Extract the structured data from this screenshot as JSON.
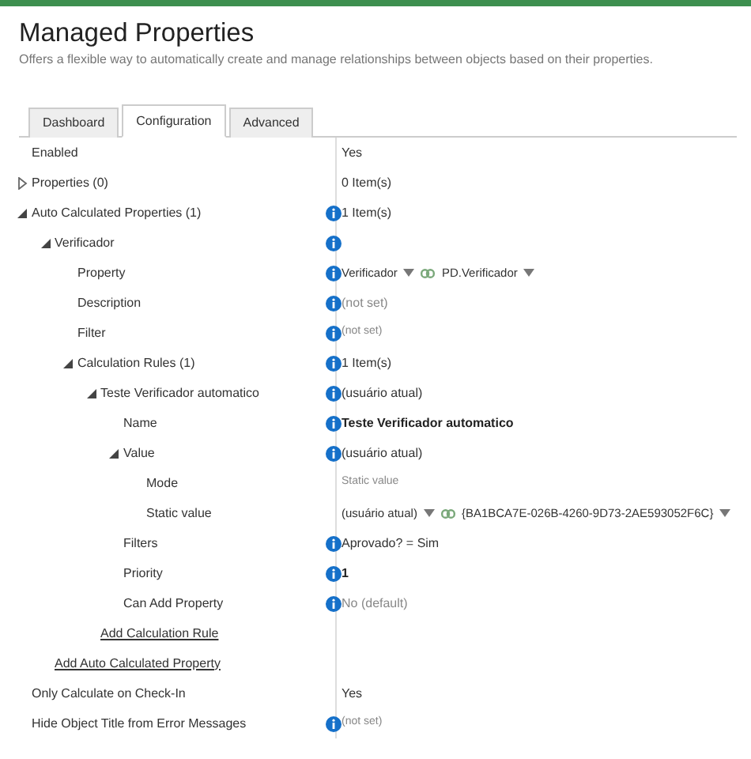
{
  "header": {
    "title": "Managed Properties",
    "subtitle": "Offers a flexible way to automatically create and manage relationships between objects based on their properties."
  },
  "tabs": [
    {
      "label": "Dashboard",
      "selected": false
    },
    {
      "label": "Configuration",
      "selected": true
    },
    {
      "label": "Advanced",
      "selected": false
    }
  ],
  "properties": [
    {
      "kind": "row",
      "label": "Enabled",
      "info": false,
      "value": {
        "kind": "plain",
        "text": "Yes"
      }
    },
    {
      "kind": "row",
      "label": "Properties (0)",
      "expanded": false,
      "info": false,
      "value": {
        "kind": "plain",
        "text": "0 Item(s)"
      }
    },
    {
      "kind": "row",
      "label": "Auto Calculated Properties (1)",
      "expanded": true,
      "info": true,
      "value": {
        "kind": "plain",
        "text": "1 Item(s)"
      },
      "children": [
        {
          "kind": "row",
          "label": "Verificador",
          "expanded": true,
          "info": true,
          "children": [
            {
              "kind": "row",
              "label": "Property",
              "info": true,
              "value": {
                "kind": "lookup",
                "left": "Verificador",
                "right": "PD.Verificador"
              }
            },
            {
              "kind": "row",
              "label": "Description",
              "info": true,
              "value": {
                "kind": "muted",
                "text": "(not set)"
              }
            },
            {
              "kind": "row",
              "label": "Filter",
              "info": true,
              "value": {
                "kind": "small",
                "text": "(not set)"
              }
            },
            {
              "kind": "row",
              "label": "Calculation Rules (1)",
              "expanded": true,
              "info": true,
              "value": {
                "kind": "plain",
                "text": "1 Item(s)"
              },
              "children": [
                {
                  "kind": "row",
                  "label": "Teste Verificador automatico",
                  "expanded": true,
                  "info": true,
                  "value": {
                    "kind": "plain",
                    "text": "(usuário atual)"
                  },
                  "children": [
                    {
                      "kind": "row",
                      "label": "Name",
                      "info": true,
                      "value": {
                        "kind": "bold",
                        "text": "Teste Verificador automatico"
                      }
                    },
                    {
                      "kind": "row",
                      "label": "Value",
                      "expanded": true,
                      "info": true,
                      "value": {
                        "kind": "plain",
                        "text": "(usuário atual)"
                      },
                      "children": [
                        {
                          "kind": "row",
                          "label": "Mode",
                          "info": false,
                          "value": {
                            "kind": "small",
                            "text": "Static value"
                          }
                        },
                        {
                          "kind": "row",
                          "label": "Static value",
                          "info": false,
                          "value": {
                            "kind": "lookup",
                            "left": "(usuário atual)",
                            "right": "{BA1BCA7E-026B-4260-9D73-2AE593052F6C}"
                          }
                        }
                      ]
                    },
                    {
                      "kind": "row",
                      "label": "Filters",
                      "info": true,
                      "value": {
                        "kind": "plain",
                        "text": "Aprovado?  =  Sim"
                      }
                    },
                    {
                      "kind": "row",
                      "label": "Priority",
                      "info": true,
                      "value": {
                        "kind": "bold",
                        "text": "1"
                      }
                    },
                    {
                      "kind": "row",
                      "label": "Can Add Property",
                      "info": true,
                      "value": {
                        "kind": "muted",
                        "text": "No (default)"
                      }
                    }
                  ]
                },
                {
                  "kind": "link",
                  "label": "Add Calculation Rule"
                }
              ]
            }
          ]
        },
        {
          "kind": "link",
          "label": "Add Auto Calculated Property"
        }
      ]
    },
    {
      "kind": "row",
      "label": "Only Calculate on Check-In",
      "info": false,
      "value": {
        "kind": "plain",
        "text": "Yes"
      }
    },
    {
      "kind": "row",
      "label": "Hide Object Title from Error Messages",
      "info": true,
      "value": {
        "kind": "small",
        "text": "(not set)"
      }
    }
  ]
}
